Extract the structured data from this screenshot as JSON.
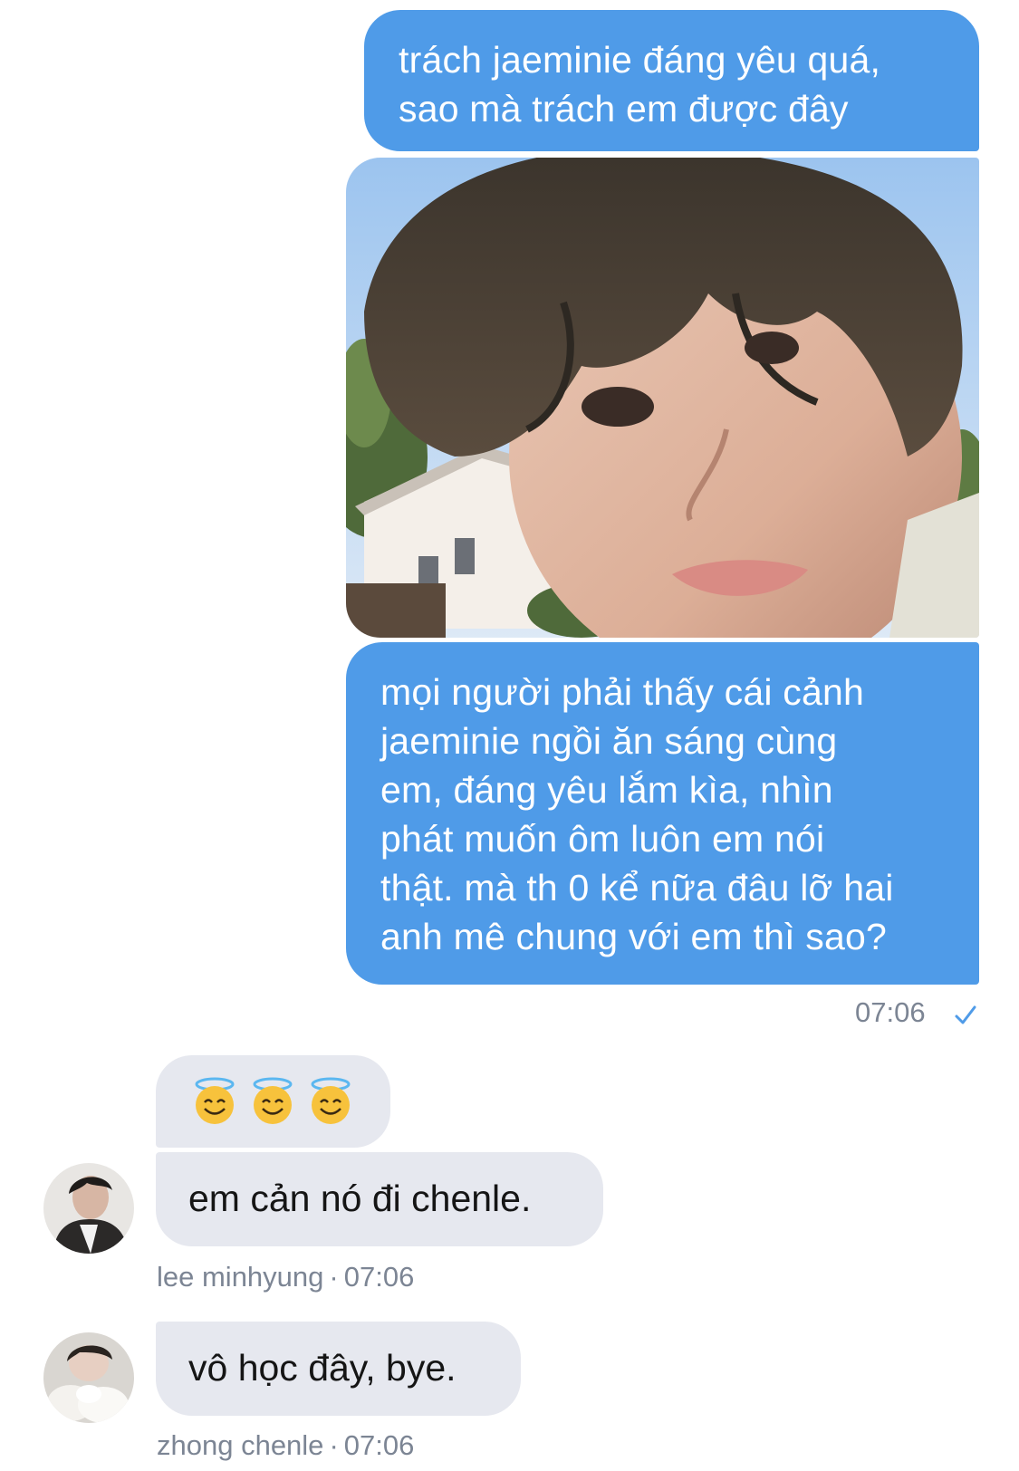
{
  "messages_out": {
    "first": {
      "lines": [
        "trách jaeminie đáng yêu quá,",
        "sao mà trách em được đây"
      ]
    },
    "photo": {
      "icon": "photo-image"
    },
    "second": {
      "lines": [
        "mọi người phải thấy cái cảnh",
        "jaeminie ngồi ăn sáng cùng",
        "em, đáng yêu lắm kìa, nhìn",
        "phát muốn ôm luôn em nói",
        "thật. mà th 0 kể nữa đâu lỡ hai",
        "anh mê chung với em thì sao?"
      ],
      "time": "07:06",
      "status_icon": "read-check-icon"
    }
  },
  "messages_in": [
    {
      "emoji_icon": "smiling-face-with-halo-emoji",
      "emoji_count": 3
    },
    {
      "text": "em cản nó đi chenle.",
      "sender": "lee minhyung",
      "separator": "·",
      "time": "07:06"
    },
    {
      "text": "vô học đây, bye.",
      "sender": "zhong chenle",
      "separator": "·",
      "time": "07:06"
    }
  ],
  "colors": {
    "outgoing_bubble": "#4f9be8",
    "incoming_bubble": "#e6e8ef",
    "meta_text": "#7c8594",
    "check": "#4f9be8"
  }
}
